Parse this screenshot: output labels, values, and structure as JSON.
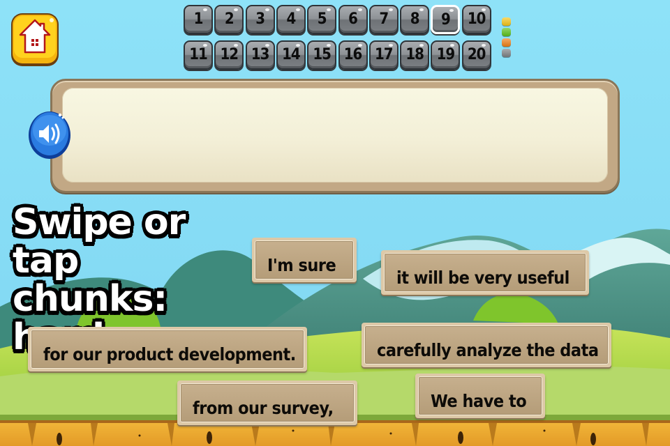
{
  "header": {
    "home_icon": "home-icon",
    "levels": [
      {
        "label": "1"
      },
      {
        "label": "2"
      },
      {
        "label": "3"
      },
      {
        "label": "4"
      },
      {
        "label": "5"
      },
      {
        "label": "6"
      },
      {
        "label": "7"
      },
      {
        "label": "8"
      },
      {
        "label": "9"
      },
      {
        "label": "10"
      },
      {
        "label": "11"
      },
      {
        "label": "12"
      },
      {
        "label": "13"
      },
      {
        "label": "14"
      },
      {
        "label": "15"
      },
      {
        "label": "16"
      },
      {
        "label": "17"
      },
      {
        "label": "18"
      },
      {
        "label": "19"
      },
      {
        "label": "20"
      }
    ],
    "current_level": "9",
    "difficulty_indicator": [
      {
        "name": "yellow",
        "color": "#f5c518"
      },
      {
        "name": "green",
        "color": "#5cc21b"
      },
      {
        "name": "orange",
        "color": "#f07f15"
      },
      {
        "name": "gray",
        "color": "#7d8185"
      }
    ]
  },
  "answer_panel": {
    "text": "",
    "speaker_icon": "speaker-icon"
  },
  "instruction": {
    "line1": "Swipe or tap",
    "line2": "chunks: hard"
  },
  "chunks": [
    {
      "text": "I'm sure"
    },
    {
      "text": "it will be very useful"
    },
    {
      "text": "for our product development."
    },
    {
      "text": "carefully analyze the data"
    },
    {
      "text": "from our survey,"
    },
    {
      "text": "We have to"
    }
  ],
  "colors": {
    "sky": "#8fe1f7",
    "panel_frame": "#c2a885",
    "panel_fill": "#f6f3dc",
    "chunk_fill": "#bca582",
    "home_button": "#f7c81c",
    "speaker_button": "#1f6fd6"
  }
}
